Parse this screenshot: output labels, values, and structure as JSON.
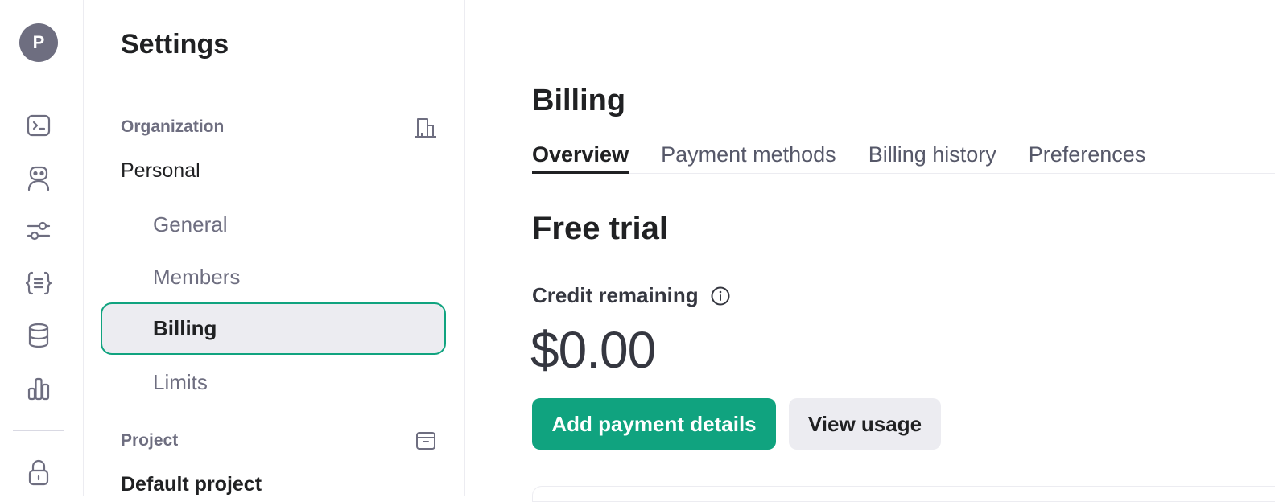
{
  "rail": {
    "avatar_letter": "P",
    "icons": [
      "terminal-icon",
      "assistant-bot-icon",
      "sliders-icon",
      "braces-icon",
      "database-icon",
      "bar-chart-icon",
      "lock-icon"
    ]
  },
  "sidebar": {
    "title": "Settings",
    "organization_label": "Organization",
    "organization_name": "Personal",
    "items": [
      {
        "label": "General",
        "active": false
      },
      {
        "label": "Members",
        "active": false
      },
      {
        "label": "Billing",
        "active": true
      },
      {
        "label": "Limits",
        "active": false
      }
    ],
    "project_label": "Project",
    "project_name": "Default project"
  },
  "main": {
    "title": "Billing",
    "tabs": [
      {
        "label": "Overview",
        "active": true
      },
      {
        "label": "Payment methods",
        "active": false
      },
      {
        "label": "Billing history",
        "active": false
      },
      {
        "label": "Preferences",
        "active": false
      }
    ],
    "plan_title": "Free trial",
    "credit_label": "Credit remaining",
    "credit_amount": "$0.00",
    "add_payment_label": "Add payment details",
    "view_usage_label": "View usage"
  },
  "colors": {
    "accent": "#10a37f",
    "text": "#202123",
    "muted": "#6e6e80",
    "surface": "#ececf1"
  }
}
